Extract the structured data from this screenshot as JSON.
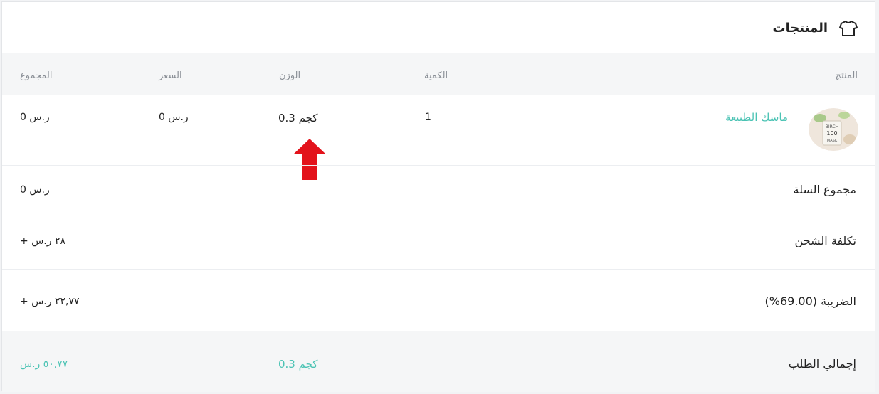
{
  "header": {
    "title": "المنتجات",
    "icon": "tshirt-icon"
  },
  "table": {
    "columns": {
      "product": "المنتج",
      "quantity": "الكمية",
      "weight": "الوزن",
      "price": "السعر",
      "total": "المجموع"
    },
    "row": {
      "product_name": "ماسك الطبيعة",
      "quantity": "1",
      "weight": "0.3 كجم",
      "price": "0 ر.س",
      "total": "0 ر.س"
    }
  },
  "summary": {
    "cart_total_label": "مجموع السلة",
    "cart_total_value": "0 ر.س",
    "shipping_label": "تكلفة الشحن",
    "shipping_value": "+ ٢٨ ر.س",
    "tax_label": "الضريبة (69.00%)",
    "tax_value": "+ ٢٢,٧٧ ر.س",
    "order_total_label": "إجمالي الطلب",
    "order_total_weight": "0.3 كجم",
    "order_total_value": "٥٠,٧٧ ر.س"
  },
  "colors": {
    "accent": "#4bc3b4",
    "arrow": "#e3121b"
  },
  "annotation_arrow": "up-arrow-icon"
}
